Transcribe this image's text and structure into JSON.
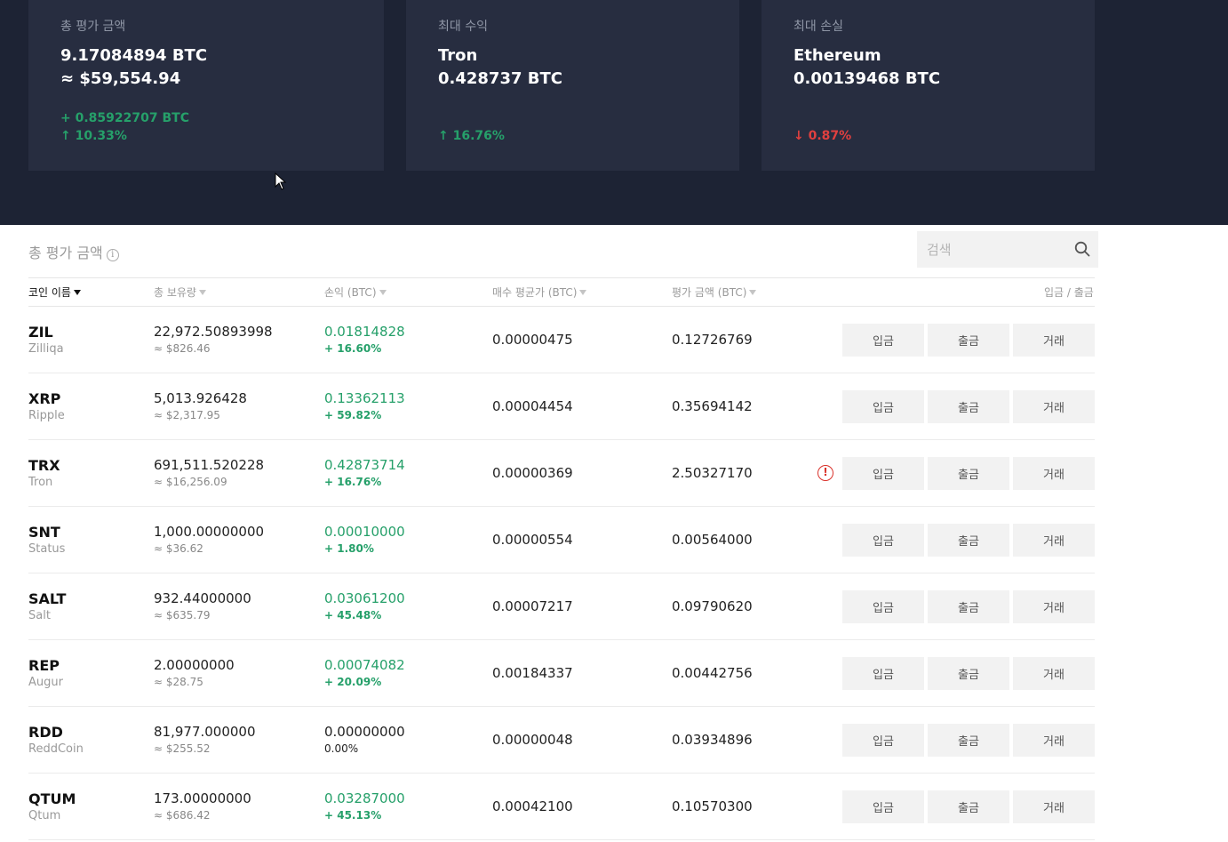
{
  "summary": [
    {
      "title": "총 평가 금액",
      "line1": "9.17084894 BTC",
      "line2": "≈ $59,554.94",
      "delta": "+ 0.85922707 BTC",
      "pct": "10.33%",
      "direction": "up"
    },
    {
      "title": "최대 수익",
      "line1": "Tron",
      "line2": "0.428737 BTC",
      "delta": "",
      "pct": "16.76%",
      "direction": "up"
    },
    {
      "title": "최대 손실",
      "line1": "Ethereum",
      "line2": "0.00139468 BTC",
      "delta": "",
      "pct": "0.87%",
      "direction": "down"
    }
  ],
  "section": {
    "title": "총 평가 금액",
    "info_icon": "info-icon"
  },
  "search": {
    "placeholder": "검색",
    "icon": "search-icon"
  },
  "table": {
    "headers": {
      "name": "코인 이름",
      "holdings": "총 보유량",
      "pl": "손익 (BTC)",
      "avg": "매수 평균가 (BTC)",
      "value": "평가 금액 (BTC)",
      "actions": "입금 / 출금"
    },
    "buttons": {
      "deposit": "입금",
      "withdraw": "출금",
      "trade": "거래"
    },
    "rows": [
      {
        "symbol": "ZIL",
        "name": "Zilliqa",
        "holdings": "22,972.50893998",
        "usd": "≈ $826.46",
        "pl": "0.01814828",
        "pl_pct": "+ 16.60%",
        "avg": "0.00000475",
        "value": "0.12726769",
        "warning": false
      },
      {
        "symbol": "XRP",
        "name": "Ripple",
        "holdings": "5,013.926428",
        "usd": "≈ $2,317.95",
        "pl": "0.13362113",
        "pl_pct": "+ 59.82%",
        "avg": "0.00004454",
        "value": "0.35694142",
        "warning": false
      },
      {
        "symbol": "TRX",
        "name": "Tron",
        "holdings": "691,511.520228",
        "usd": "≈ $16,256.09",
        "pl": "0.42873714",
        "pl_pct": "+ 16.76%",
        "avg": "0.00000369",
        "value": "2.50327170",
        "warning": true
      },
      {
        "symbol": "SNT",
        "name": "Status",
        "holdings": "1,000.00000000",
        "usd": "≈ $36.62",
        "pl": "0.00010000",
        "pl_pct": "+ 1.80%",
        "avg": "0.00000554",
        "value": "0.00564000",
        "warning": false
      },
      {
        "symbol": "SALT",
        "name": "Salt",
        "holdings": "932.44000000",
        "usd": "≈ $635.79",
        "pl": "0.03061200",
        "pl_pct": "+ 45.48%",
        "avg": "0.00007217",
        "value": "0.09790620",
        "warning": false
      },
      {
        "symbol": "REP",
        "name": "Augur",
        "holdings": "2.00000000",
        "usd": "≈ $28.75",
        "pl": "0.00074082",
        "pl_pct": "+ 20.09%",
        "avg": "0.00184337",
        "value": "0.00442756",
        "warning": false
      },
      {
        "symbol": "RDD",
        "name": "ReddCoin",
        "holdings": "81,977.000000",
        "usd": "≈ $255.52",
        "pl": "0.00000000",
        "pl_pct": "0.00%",
        "avg": "0.00000048",
        "value": "0.03934896",
        "warning": false,
        "neutral": true
      },
      {
        "symbol": "QTUM",
        "name": "Qtum",
        "holdings": "173.00000000",
        "usd": "≈ $686.42",
        "pl": "0.03287000",
        "pl_pct": "+ 45.13%",
        "avg": "0.00042100",
        "value": "0.10570300",
        "warning": false
      }
    ]
  },
  "colors": {
    "header_bg": "#1d2334",
    "card_bg": "#272d40",
    "gain": "#26a06a",
    "loss": "#e0403f"
  }
}
